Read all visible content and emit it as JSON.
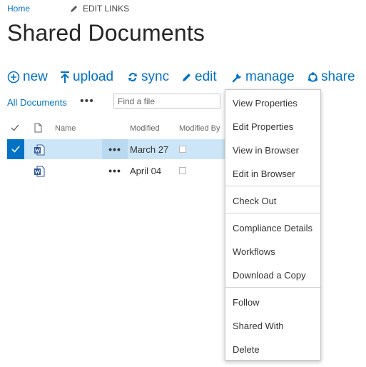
{
  "topnav": {
    "home": "Home",
    "edit_links": "EDIT LINKS"
  },
  "page_title": "Shared Documents",
  "commands": {
    "new": "new",
    "upload": "upload",
    "sync": "sync",
    "edit": "edit",
    "manage": "manage",
    "share": "share"
  },
  "view": {
    "all_documents": "All Documents",
    "more": "•••",
    "search_placeholder": "Find a file"
  },
  "columns": {
    "name": "Name",
    "modified": "Modified",
    "modified_by": "Modified By"
  },
  "rows": [
    {
      "modified": "March 27",
      "dots": "•••",
      "selected": true
    },
    {
      "modified": "April 04",
      "dots": "•••",
      "selected": false
    }
  ],
  "menu": {
    "view_properties": "View Properties",
    "edit_properties": "Edit Properties",
    "view_in_browser": "View in Browser",
    "edit_in_browser": "Edit in Browser",
    "check_out": "Check Out",
    "compliance_details": "Compliance Details",
    "workflows": "Workflows",
    "download_a_copy": "Download a Copy",
    "follow": "Follow",
    "shared_with": "Shared With",
    "delete": "Delete"
  },
  "colors": {
    "accent": "#0072c6",
    "selected_row": "#cde6f7"
  },
  "icons": [
    "pencil-icon",
    "plus-circle-icon",
    "upload-icon",
    "sync-icon",
    "wrench-icon",
    "share-icon",
    "checkmark-icon",
    "document-icon",
    "word-icon"
  ]
}
